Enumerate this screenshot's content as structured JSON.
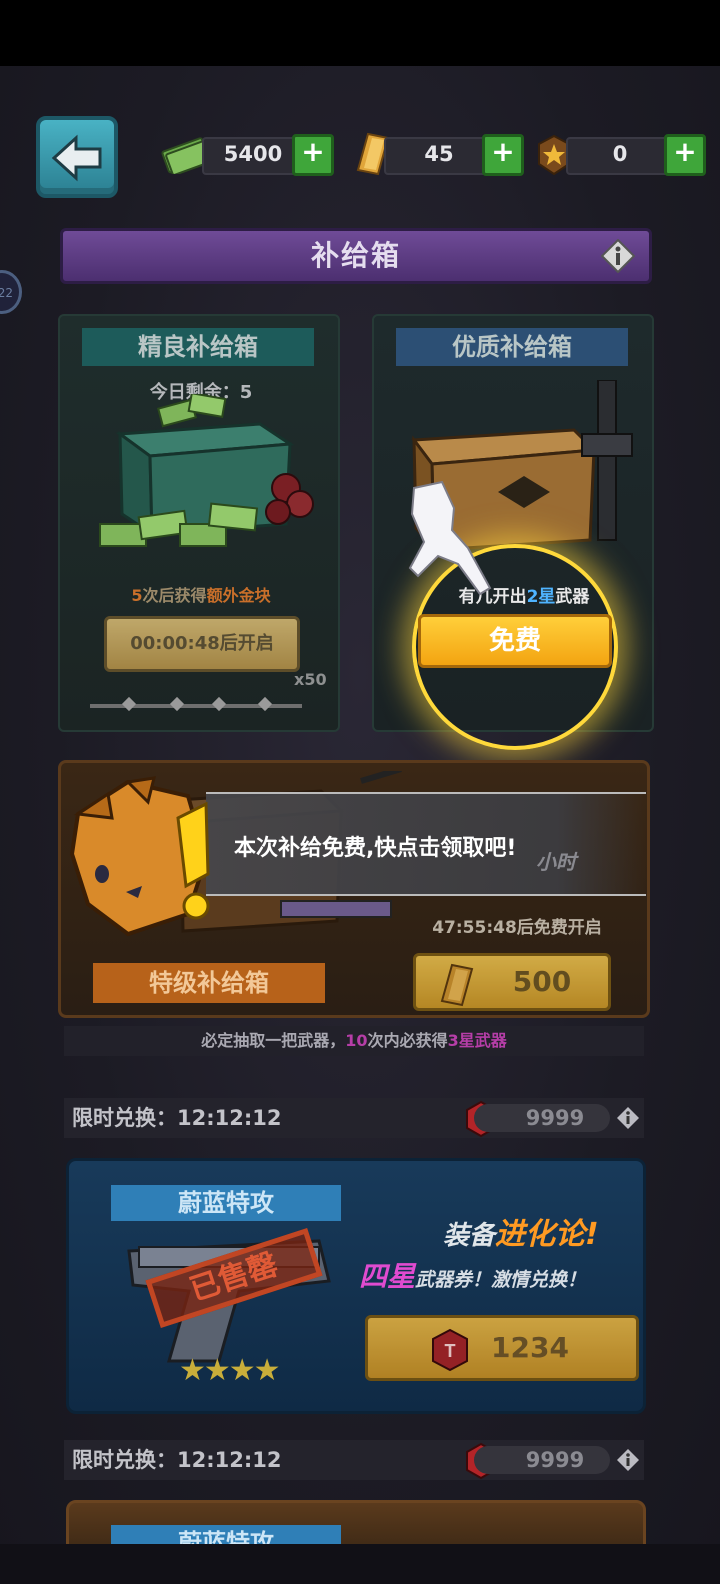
{
  "currencies": [
    {
      "icon": "cash-icon",
      "value": "5400"
    },
    {
      "icon": "gold-bar-icon",
      "value": "45"
    },
    {
      "icon": "medal-token-icon",
      "value": "0"
    }
  ],
  "title": "补给箱",
  "side_badge": "22",
  "left_crate": {
    "name": "精良补给箱",
    "remaining": "今日剩余：5",
    "bonus_prefix": "5",
    "bonus_mid": "次后获得",
    "bonus_highlight": "额外金块",
    "timer_button": "00:00:48后开启",
    "progress_label": "x50"
  },
  "right_crate": {
    "name": "优质补给箱",
    "hint_prefix": "有几",
    "hint_mid": "开出",
    "hint_star": "2星",
    "hint_suffix": "武器",
    "free_button": "免费"
  },
  "special_crate": {
    "name": "特级补给箱",
    "timer": "47:55:48后免费开启",
    "hidden_fragment": "小时",
    "price": "500",
    "guarantee_prefix": "必定抽取一把武器，",
    "guarantee_count": "10",
    "guarantee_mid": "次内必获得",
    "guarantee_highlight": "3星武器"
  },
  "dialog": {
    "text": "本次补给免费,快点击领取吧!"
  },
  "exchange_1": {
    "label": "限时兑换：12:12:12",
    "cost": "9999"
  },
  "offer": {
    "title": "蔚蓝特攻",
    "line1_prefix": "装备",
    "line1_highlight": "进化论!",
    "line2_highlight": "四星",
    "line2_suffix": "武器券！激情兑换！",
    "stamp": "已售罄",
    "stars": "★★★★",
    "price": "1234"
  },
  "exchange_2": {
    "label": "限时兑换：12:12:12",
    "cost": "9999"
  },
  "bottom_card": {
    "title": "蔚蓝特攻"
  },
  "colors": {
    "accent_gold": "#f3a411",
    "glow": "#ffd93b",
    "title_purple": "#6f4b97",
    "offer_blue": "#183a5a"
  }
}
